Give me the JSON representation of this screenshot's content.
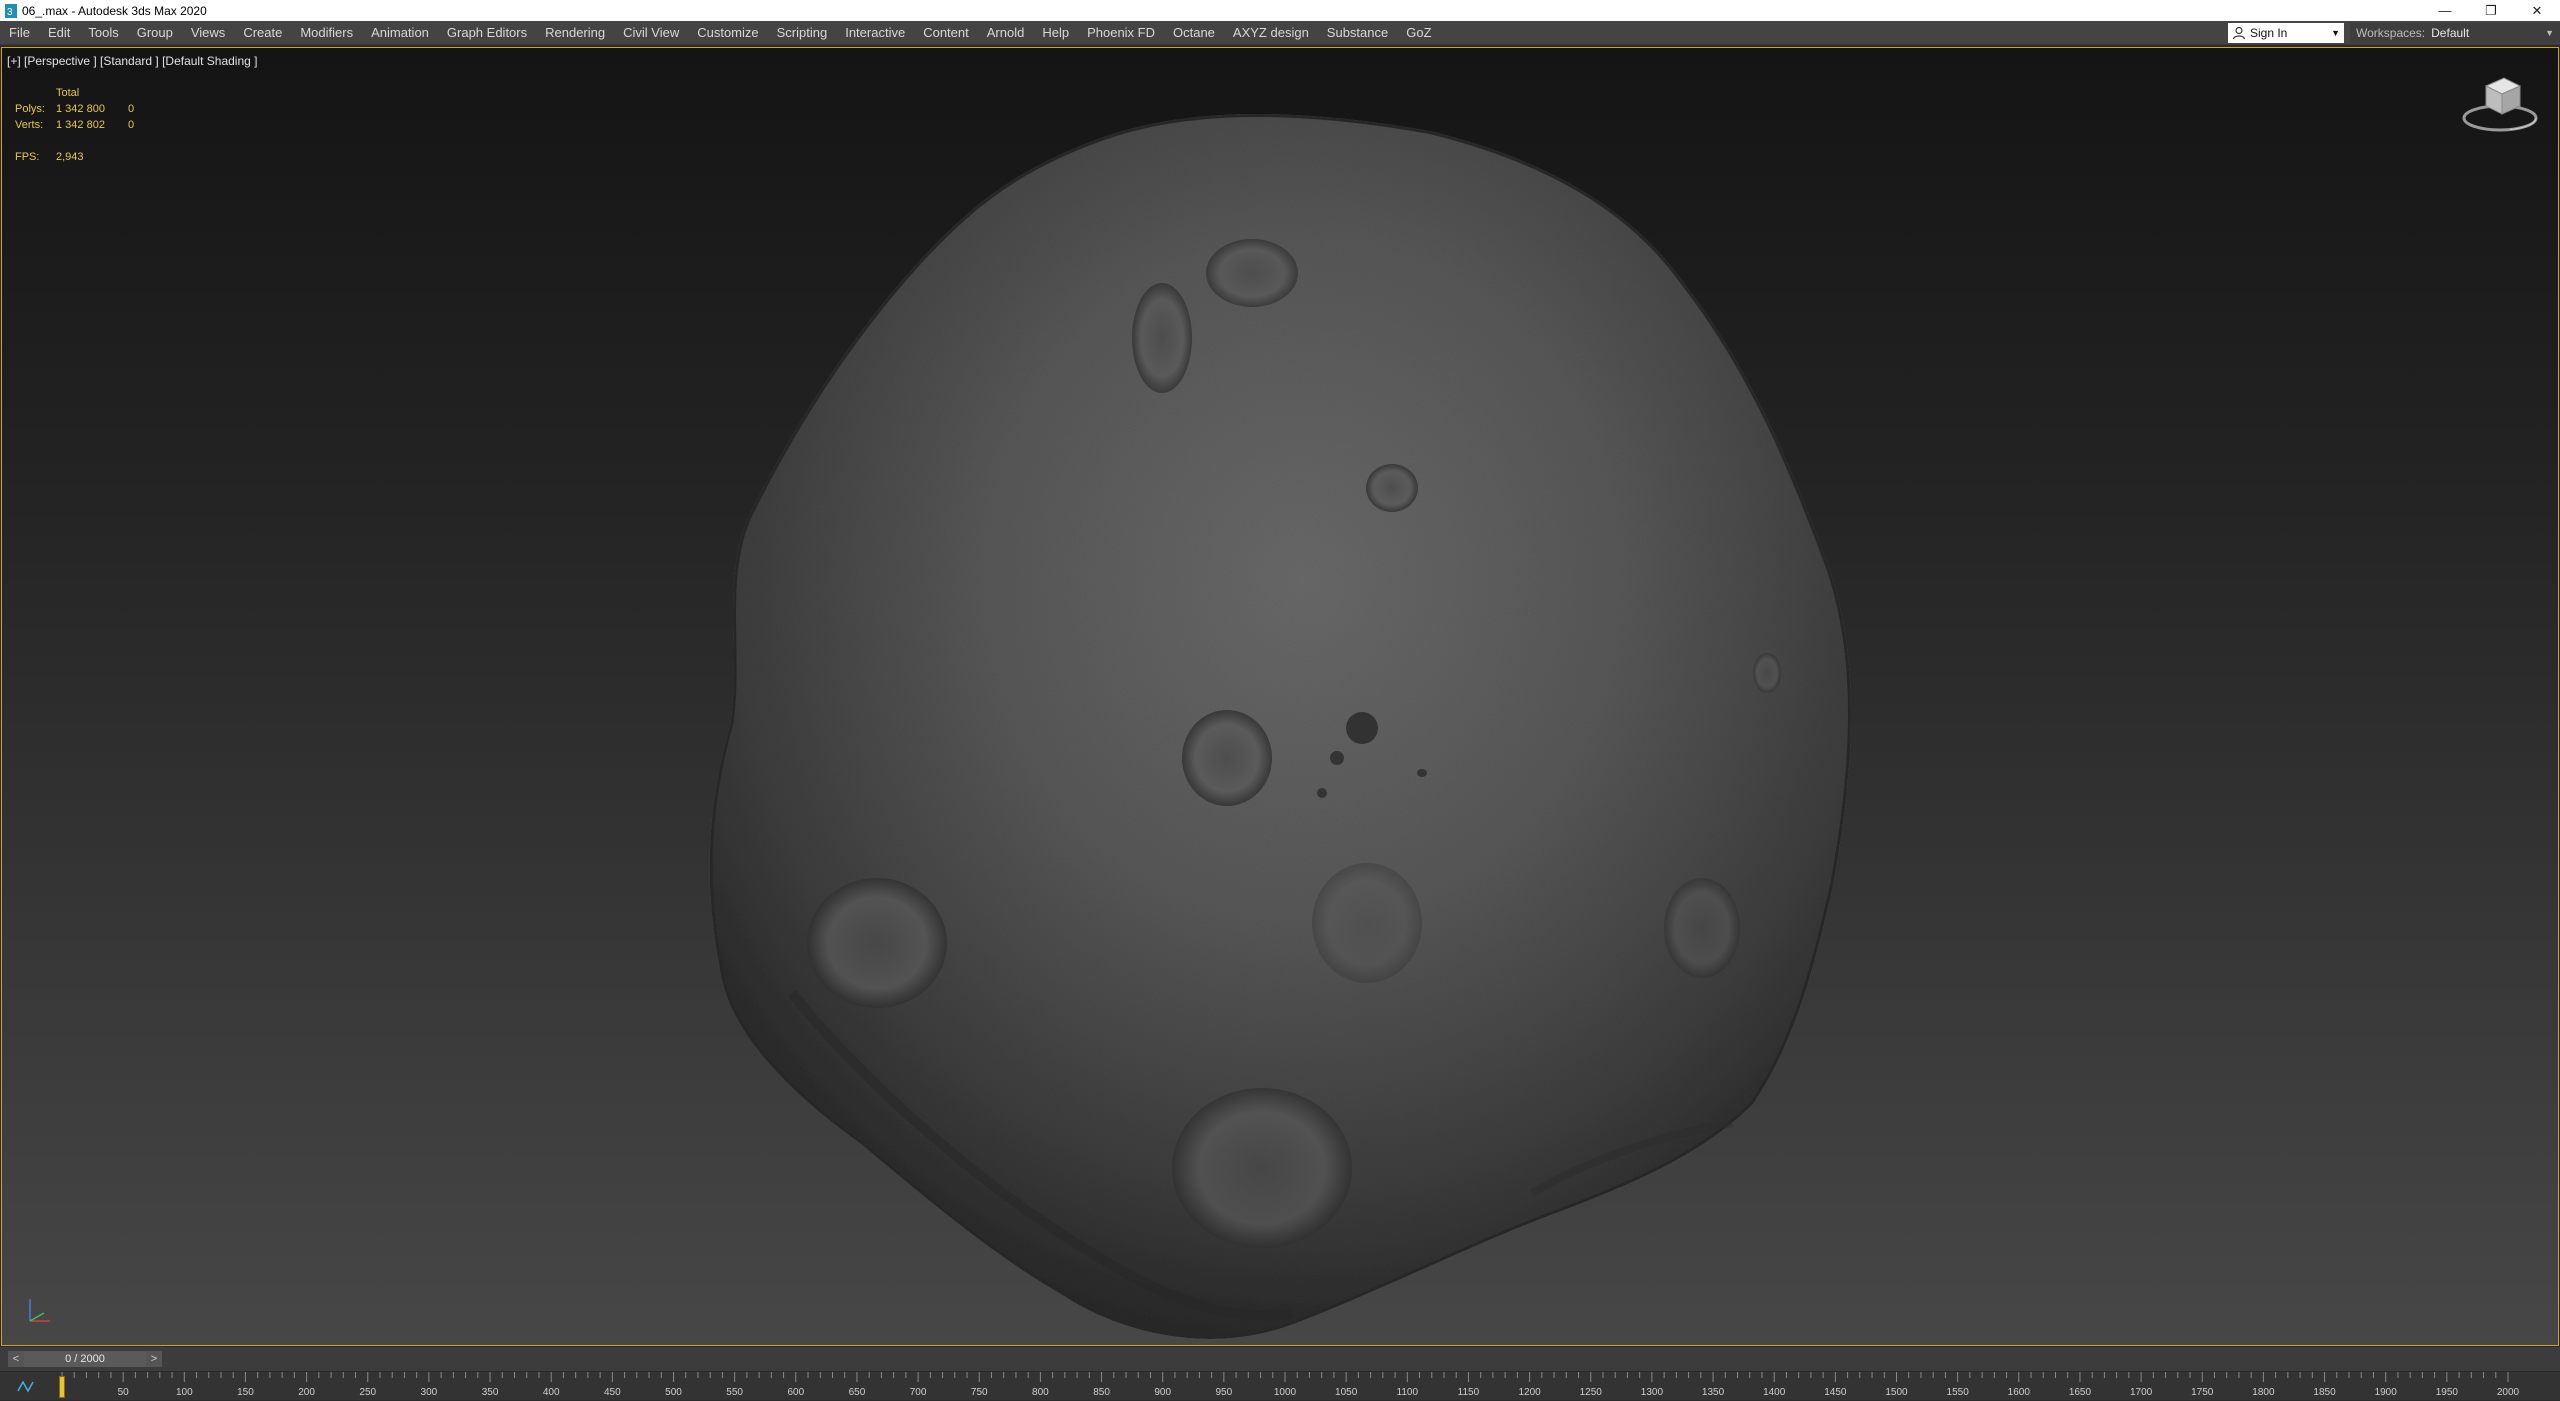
{
  "window": {
    "title": "06_.max - Autodesk 3ds Max 2020",
    "icon": "app-3dsmax-icon",
    "controls": [
      "minimize-icon",
      "restore-icon",
      "close-icon"
    ]
  },
  "menu": {
    "items": [
      "File",
      "Edit",
      "Tools",
      "Group",
      "Views",
      "Create",
      "Modifiers",
      "Animation",
      "Graph Editors",
      "Rendering",
      "Civil View",
      "Customize",
      "Scripting",
      "Interactive",
      "Content",
      "Arnold",
      "Help",
      "Phoenix FD",
      "Octane",
      "AXYZ design",
      "Substance",
      "GoZ"
    ],
    "sign_in": "Sign In",
    "workspaces_label": "Workspaces:",
    "workspaces_value": "Default"
  },
  "viewport": {
    "label": "[+] [Perspective ] [Standard ] [Default Shading ]",
    "stats": {
      "total_header": "Total",
      "polys_label": "Polys:",
      "polys_total": "1 342 800",
      "polys_sel": "0",
      "verts_label": "Verts:",
      "verts_total": "1 342 802",
      "verts_sel": "0",
      "fps_label": "FPS:",
      "fps_value": "2,943"
    },
    "colors": {
      "stats_text": "#e8c84c",
      "active_border": "#c9a227"
    }
  },
  "time_slider": {
    "value": "0 / 2000",
    "prev": "<",
    "next": ">"
  },
  "timeline": {
    "ticks": [
      "50",
      "100",
      "150",
      "200",
      "250",
      "300",
      "350",
      "400",
      "450",
      "500",
      "550",
      "600",
      "650",
      "700",
      "750",
      "800",
      "850",
      "900",
      "950",
      "1000",
      "1050",
      "1100",
      "1150",
      "1200",
      "1250",
      "1300",
      "1350",
      "1400",
      "1450",
      "1500",
      "1550",
      "1600",
      "1650",
      "1700",
      "1750",
      "1800",
      "1850",
      "1900",
      "1950",
      "2000"
    ]
  }
}
